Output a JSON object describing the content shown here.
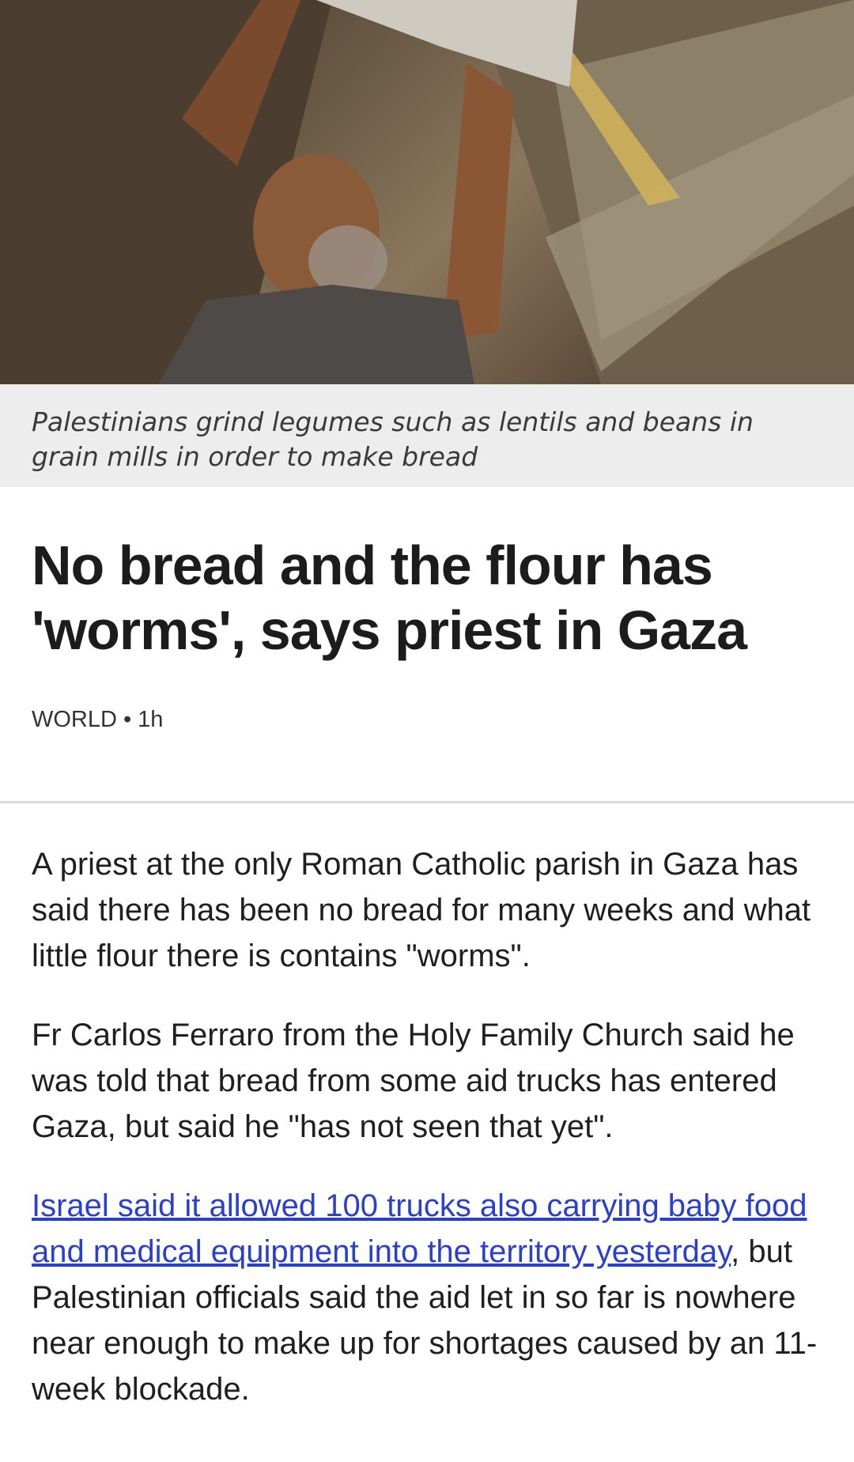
{
  "hero": {
    "image_alt": "Man pouring legumes from a bag into a grain mill",
    "caption": "Palestinians grind legumes such as lentils and beans in grain mills in order to make bread"
  },
  "article": {
    "headline": "No bread and the flour has 'worms', says priest in Gaza",
    "section": "WORLD",
    "separator": "•",
    "time": "1h",
    "paragraphs": [
      "A priest at the only Roman Catholic parish in Gaza has said there has been no bread for many weeks and what little flour there is contains \"worms\".",
      "Fr Carlos Ferraro from the Holy Family Church said he was told that bread from some aid trucks has entered Gaza, but said he \"has not seen that yet\"."
    ],
    "para3_link": "Israel said it allowed 100 trucks also carrying baby food and medical equipment into the territory yesterday",
    "para3_rest": ", but Palestinian officials said the aid let in so far is nowhere near enough to make up for shortages caused by an 11-week blockade."
  },
  "colors": {
    "link": "#2a3fd0",
    "caption_bg": "#ededed",
    "divider": "#dcdcdc"
  }
}
